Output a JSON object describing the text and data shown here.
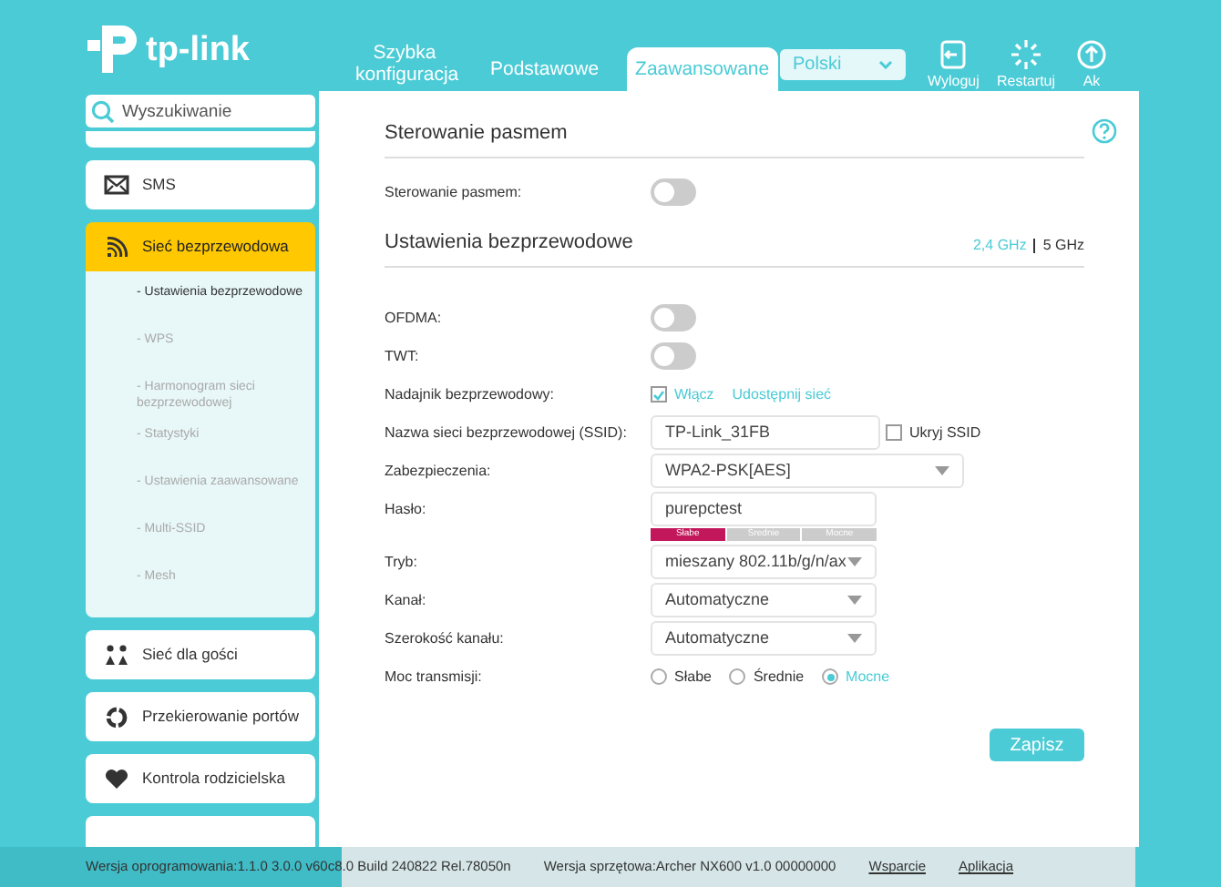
{
  "header": {
    "logo": "tp-link",
    "tabs": [
      {
        "label": "Szybka konfiguracja",
        "selected": false
      },
      {
        "label": "Podstawowe",
        "selected": false
      },
      {
        "label": "Zaawansowane",
        "selected": true
      }
    ],
    "language": "Polski",
    "actions": [
      {
        "label": "Wyloguj",
        "kind": "logout"
      },
      {
        "label": "Restartuj",
        "kind": "restart"
      },
      {
        "label": "Ak",
        "kind": "update"
      }
    ]
  },
  "sidebar": {
    "search_placeholder": "Wyszukiwanie",
    "items": [
      {
        "label": "SMS",
        "kind": "mail",
        "selected": false
      },
      {
        "label": "Sieć bezprzewodowa",
        "kind": "wifi",
        "selected": true,
        "children": [
          {
            "label": "- Ustawienia bezprzewodowe",
            "selected": true
          },
          {
            "label": "- WPS",
            "selected": false
          },
          {
            "label": "- Harmonogram sieci bezprzewodowej",
            "selected": false
          },
          {
            "label": "- Statystyki",
            "selected": false
          },
          {
            "label": "- Ustawienia zaawansowane",
            "selected": false
          },
          {
            "label": "- Multi-SSID",
            "selected": false
          },
          {
            "label": "- Mesh",
            "selected": false
          }
        ]
      },
      {
        "label": "Sieć dla gości",
        "kind": "guests",
        "selected": false
      },
      {
        "label": "Przekierowanie portów",
        "kind": "ports",
        "selected": false
      },
      {
        "label": "Kontrola rodzicielska",
        "kind": "heart",
        "selected": false
      }
    ]
  },
  "sections": [
    {
      "title": "Sterowanie pasmem",
      "rows": [
        {
          "kind": "toggle",
          "label": "Sterowanie pasmem:",
          "on": false
        }
      ]
    },
    {
      "title": "Ustawienia bezprzewodowe",
      "bands": [
        {
          "label": "2,4 GHz",
          "selected": true
        },
        {
          "label": "5 GHz",
          "selected": false
        }
      ],
      "rows": [
        {
          "kind": "toggle",
          "label": "OFDMA:",
          "on": false
        },
        {
          "kind": "toggle",
          "label": "TWT:",
          "on": false
        },
        {
          "kind": "checkbox",
          "label": "Nadajnik bezprzewodowy:",
          "option": "Włącz",
          "checked": true,
          "link": "Udostępnij sieć"
        },
        {
          "kind": "text",
          "label": "Nazwa sieci bezprzewodowej (SSID):",
          "value": "TP-Link_31FB",
          "option": "Ukryj SSID",
          "checked": false
        },
        {
          "kind": "select",
          "label": "Zabezpieczenia:",
          "value": "WPA2-PSK[AES]",
          "wide": true
        },
        {
          "kind": "password",
          "label": "Hasło:",
          "value": "purepctest",
          "strength": [
            {
              "label": "Słabe",
              "selected": true
            },
            {
              "label": "Średnie",
              "selected": false
            },
            {
              "label": "Mocne",
              "selected": false
            }
          ]
        },
        {
          "kind": "select",
          "label": "Tryb:",
          "value": "mieszany 802.11b/g/n/ax",
          "wide": false
        },
        {
          "kind": "select",
          "label": "Kanał:",
          "value": "Automatyczne",
          "wide": false
        },
        {
          "kind": "select",
          "label": "Szerokość kanału:",
          "value": "Automatyczne",
          "wide": false
        },
        {
          "kind": "radio",
          "label": "Moc transmisji:",
          "options": [
            {
              "label": "Słabe",
              "selected": false
            },
            {
              "label": "Średnie",
              "selected": false
            },
            {
              "label": "Mocne",
              "selected": true
            }
          ]
        }
      ]
    }
  ],
  "save_button": "Zapisz",
  "footer": {
    "firmware": "Wersja oprogramowania:1.1.0 3.0.0 v60c8.0 Build 240822 Rel.78050n",
    "hardware": "Wersja sprzętowa:Archer NX600 v1.0 00000000",
    "links": [
      "Wsparcie",
      "Aplikacja"
    ]
  }
}
